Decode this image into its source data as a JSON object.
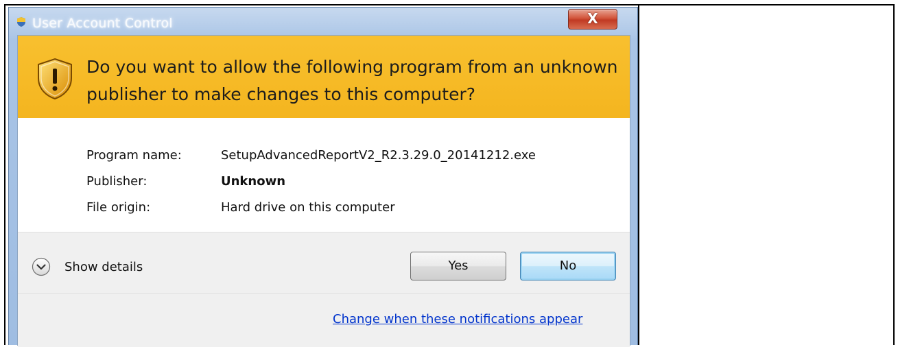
{
  "dialog": {
    "title": "User Account Control",
    "close_label": "X",
    "question": "Do you want to allow the following program from an unknown publisher to make changes to this computer?",
    "info": {
      "program_name_label": "Program name:",
      "program_name_value": "SetupAdvancedReportV2_R2.3.29.0_20141212.exe",
      "publisher_label": "Publisher:",
      "publisher_value": "Unknown",
      "file_origin_label": "File origin:",
      "file_origin_value": "Hard drive on this computer"
    },
    "footer": {
      "details_toggle_label": "Show details",
      "details_toggle_icon": "chevron-down-icon",
      "yes_label": "Yes",
      "no_label": "No",
      "link_label": "Change when these notifications appear"
    }
  },
  "colors": {
    "banner": "#F5B623",
    "link": "#0033CC",
    "close_button": "#C94A31"
  }
}
